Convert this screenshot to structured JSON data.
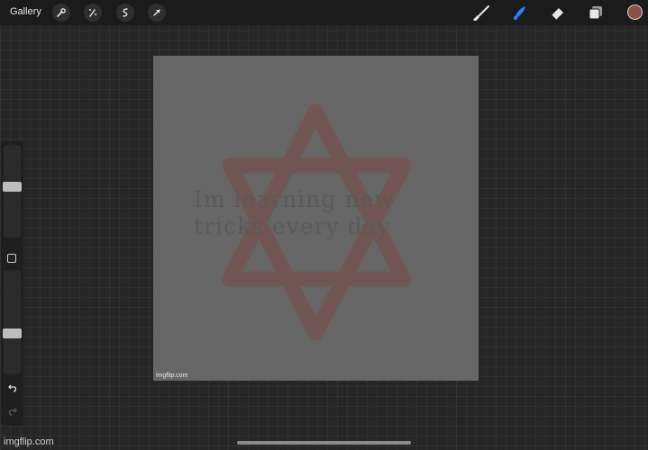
{
  "toolbar": {
    "gallery_label": "Gallery",
    "left_tools": [
      "wrench-icon",
      "magic-wand-icon",
      "selection-icon",
      "transform-arrow-icon"
    ],
    "right_tools": [
      "brush-icon",
      "smudge-icon",
      "eraser-icon",
      "layers-icon"
    ],
    "active_tool": "smudge-icon",
    "accent_color": "#2f7cf6",
    "current_color": "#8a5048"
  },
  "sidebar": {
    "brush_size_level": 0.55,
    "opacity_level": 0.38,
    "undo_icon": "undo-icon",
    "redo_icon": "redo-icon"
  },
  "canvas": {
    "text_line1": "Im learning new",
    "text_line2": "tricks every day",
    "star_color": "#7a4a44",
    "watermark": "imgflip.com"
  },
  "footer": {
    "watermark": "imgflip.com"
  }
}
